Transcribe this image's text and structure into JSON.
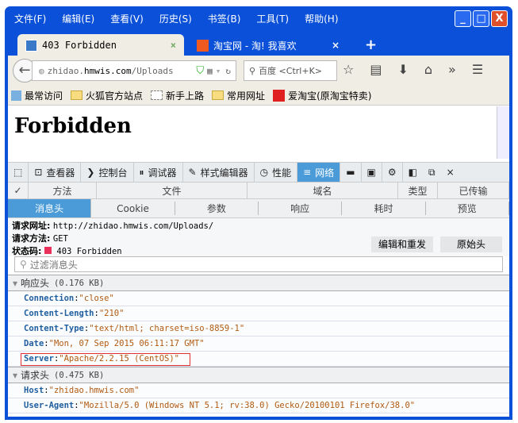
{
  "menu": [
    "文件(F)",
    "编辑(E)",
    "查看(V)",
    "历史(S)",
    "书签(B)",
    "工具(T)",
    "帮助(H)"
  ],
  "window_buttons": {
    "minimize": "_",
    "maximize": "□",
    "close": "X"
  },
  "tabs": [
    {
      "title": "403 Forbidden",
      "icon": "page-icon"
    },
    {
      "title": "淘宝网 - 淘! 我喜欢",
      "icon": "taobao-icon"
    }
  ],
  "tab_close": "×",
  "new_tab": "+",
  "address": {
    "host_prefix": "zhidao.",
    "host_main": "hmwis.com",
    "path": "/Uploads"
  },
  "search_placeholder": "百度 <Ctrl+K>",
  "bookmarks": [
    "最常访问",
    "火狐官方站点",
    "新手上路",
    "常用网址",
    "爱淘宝(原淘宝特卖)"
  ],
  "page": {
    "heading": "Forbidden"
  },
  "devtools": {
    "tools": [
      "查看器",
      "控制台",
      "调试器",
      "样式编辑器",
      "性能",
      "网络"
    ],
    "columns": [
      "✓",
      "方法",
      "文件",
      "域名",
      "类型",
      "已传输"
    ],
    "subtabs": [
      "消息头",
      "Cookie",
      "参数",
      "响应",
      "耗时",
      "预览"
    ],
    "request_url_label": "请求网址:",
    "request_url": "http://zhidao.hmwis.com/Uploads/",
    "method_label": "请求方法:",
    "method": "GET",
    "status_label": "状态码:",
    "status": "403 Forbidden",
    "status_color": "#e8305a",
    "edit_resend": "编辑和重发",
    "raw_headers": "原始头",
    "filter_placeholder": "过滤消息头",
    "response_section": {
      "title": "响应头",
      "size": "(0.176 KB)",
      "headers": [
        {
          "k": "Connection",
          "v": "\"close\""
        },
        {
          "k": "Content-Length",
          "v": "\"210\""
        },
        {
          "k": "Content-Type",
          "v": "\"text/html; charset=iso-8859-1\""
        },
        {
          "k": "Date",
          "v": "\"Mon, 07 Sep 2015 06:11:17 GMT\""
        },
        {
          "k": "Server",
          "v": "\"Apache/2.2.15 (CentOS)\""
        }
      ]
    },
    "request_section": {
      "title": "请求头",
      "size": "(0.475 KB)",
      "headers": [
        {
          "k": "Host",
          "v": "\"zhidao.hmwis.com\""
        },
        {
          "k": "User-Agent",
          "v": "\"Mozilla/5.0 (Windows NT 5.1; rv:38.0) Gecko/20100101 Firefox/38.0\""
        }
      ]
    }
  }
}
